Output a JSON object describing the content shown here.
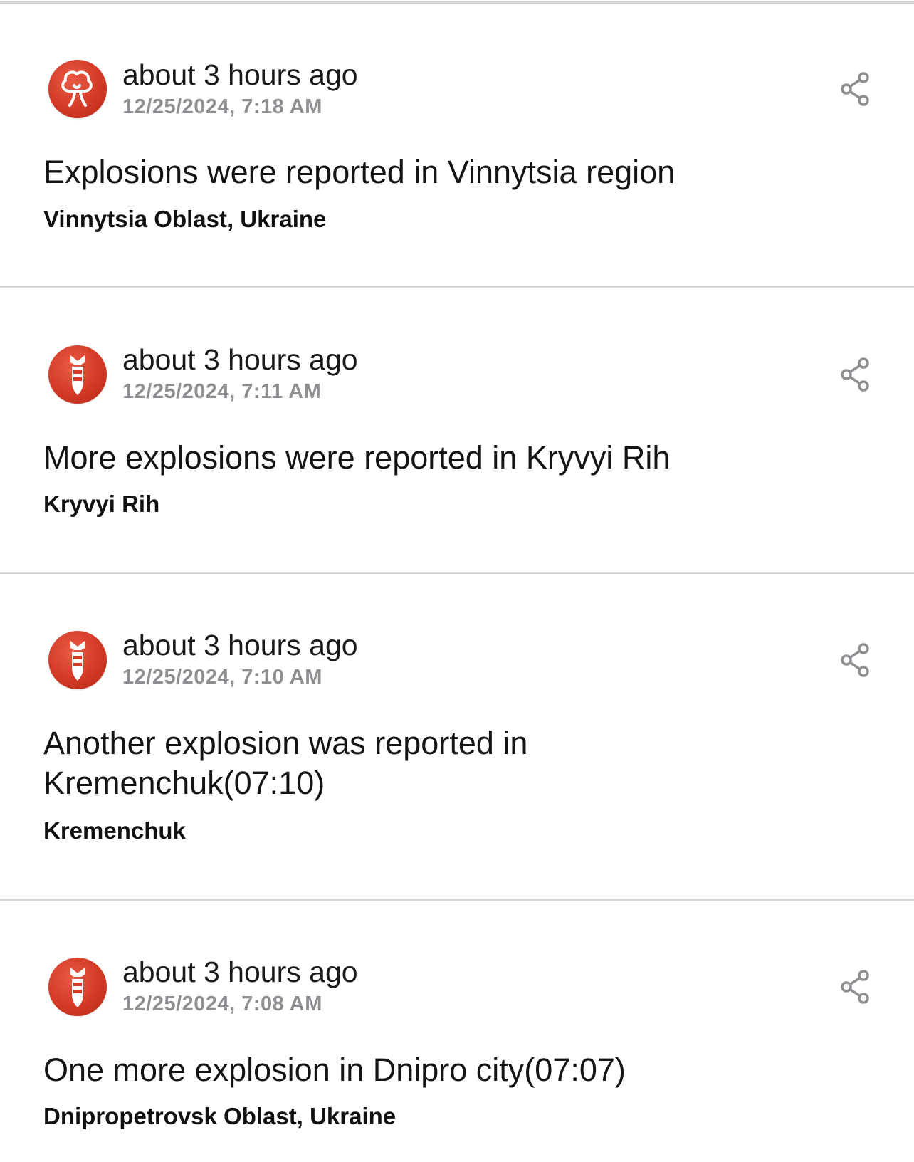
{
  "colors": {
    "background": "#ffffff",
    "divider": "#d4d4d6",
    "avatar_red": "#d23a26",
    "timestamp_gray": "#8e8e93",
    "share_icon_gray": "#8e8e93"
  },
  "feed": {
    "items": [
      {
        "icon": "explosion-mushroom-icon",
        "time_ago": "about 3 hours ago",
        "timestamp": "12/25/2024, 7:18 AM",
        "headline": "Explosions were reported in Vinnytsia region",
        "location": "Vinnytsia Oblast, Ukraine",
        "share_icon": "share-icon"
      },
      {
        "icon": "bomb-icon",
        "time_ago": "about 3 hours ago",
        "timestamp": "12/25/2024, 7:11 AM",
        "headline": "More explosions were reported in Kryvyi Rih",
        "location": "Kryvyi Rih",
        "share_icon": "share-icon"
      },
      {
        "icon": "bomb-icon",
        "time_ago": "about 3 hours ago",
        "timestamp": "12/25/2024, 7:10 AM",
        "headline": "Another explosion was reported in Kremenchuk(07:10)",
        "location": "Kremenchuk",
        "share_icon": "share-icon"
      },
      {
        "icon": "bomb-icon",
        "time_ago": "about 3 hours ago",
        "timestamp": "12/25/2024, 7:08 AM",
        "headline": "One more explosion in Dnipro city(07:07)",
        "location": "Dnipropetrovsk Oblast, Ukraine",
        "share_icon": "share-icon"
      }
    ]
  }
}
